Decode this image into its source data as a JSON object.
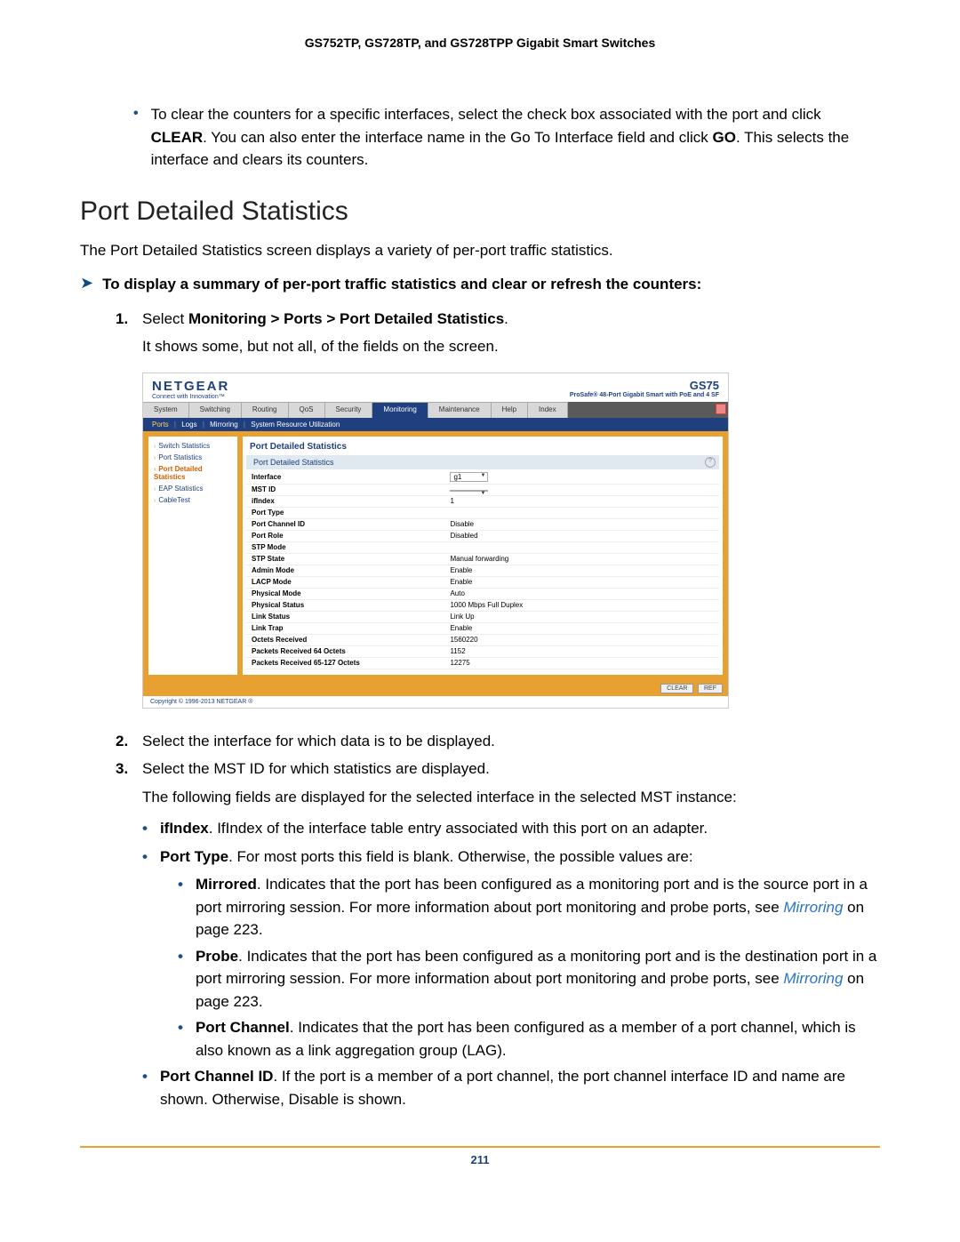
{
  "doc_header": "GS752TP, GS728TP, and GS728TPP Gigabit Smart Switches",
  "top_bullet": {
    "text": "To clear the counters for a specific interfaces, select the check box associated with the port and click ",
    "btn1": "CLEAR",
    "mid": ". You can also enter the interface name in the Go To Interface field and click ",
    "btn2": "GO",
    "tail": ". This selects the interface and clears its counters."
  },
  "section_title": "Port Detailed Statistics",
  "intro": "The Port Detailed Statistics screen displays a variety of per-port traffic statistics.",
  "lead": "To display a summary of per-port traffic statistics and clear or refresh the counters:",
  "step1": {
    "pre": "Select ",
    "path": "Monitoring > Ports > Port Detailed Statistics",
    "post": "."
  },
  "step1_sub": "It shows some, but not all, of the fields on the screen.",
  "screenshot": {
    "brand": "NETGEAR",
    "tagline": "Connect with Innovation™",
    "model": "GS75",
    "model_desc": "ProSafe® 48-Port Gigabit Smart\nwith PoE and 4 SF",
    "top_tabs": [
      "System",
      "Switching",
      "Routing",
      "QoS",
      "Security",
      "Monitoring",
      "Maintenance",
      "Help",
      "Index"
    ],
    "top_active": "Monitoring",
    "sub_tabs": [
      "Ports",
      "Logs",
      "Mirroring",
      "System Resource Utilization"
    ],
    "sub_active": "Ports",
    "side_nav": [
      "Switch Statistics",
      "Port Statistics",
      "Port Detailed Statistics",
      "EAP Statistics",
      "CableTest"
    ],
    "side_active": "Port Detailed Statistics",
    "panel_title": "Port Detailed Statistics",
    "inner_title": "Port Detailed Statistics",
    "rows": [
      {
        "label": "Interface",
        "value": "g1",
        "select": true
      },
      {
        "label": "MST ID",
        "value": "",
        "select": true
      },
      {
        "label": "ifIndex",
        "value": "1"
      },
      {
        "label": "Port Type",
        "value": ""
      },
      {
        "label": "Port Channel ID",
        "value": "Disable"
      },
      {
        "label": "Port Role",
        "value": "Disabled"
      },
      {
        "label": "STP Mode",
        "value": ""
      },
      {
        "label": "STP State",
        "value": "Manual forwarding"
      },
      {
        "label": "Admin Mode",
        "value": "Enable"
      },
      {
        "label": "LACP Mode",
        "value": "Enable"
      },
      {
        "label": "Physical Mode",
        "value": "Auto"
      },
      {
        "label": "Physical Status",
        "value": "1000 Mbps Full Duplex"
      },
      {
        "label": "Link Status",
        "value": "Link Up"
      },
      {
        "label": "Link Trap",
        "value": "Enable"
      },
      {
        "label": "Octets Received",
        "value": "1560220"
      },
      {
        "label": "Packets Received 64 Octets",
        "value": "1152"
      },
      {
        "label": "Packets Received 65-127 Octets",
        "value": "12275"
      }
    ],
    "buttons": [
      "CLEAR",
      "REF"
    ],
    "copyright": "Copyright © 1996-2013 NETGEAR ®"
  },
  "step2": "Select the interface for which data is to be displayed.",
  "step3": "Select the MST ID for which statistics are displayed.",
  "step3_sub": "The following fields are displayed for the selected interface in the selected MST instance:",
  "fields": {
    "ifindex": {
      "name": "ifIndex",
      "desc": ". IfIndex of the interface table entry associated with this port on an adapter."
    },
    "porttype": {
      "name": "Port Type",
      "desc": ". For most ports this field is blank. Otherwise, the possible values are:"
    },
    "mirrored": {
      "name": "Mirrored",
      "desc": ". Indicates that the port has been configured as a monitoring port and is the source port in a port mirroring session. For more information about port monitoring and probe ports, see ",
      "xref": "Mirroring",
      "tail": " on page 223."
    },
    "probe": {
      "name": "Probe",
      "desc": ". Indicates that the port has been configured as a monitoring port and is the destination port in a port mirroring session. For more information about port monitoring and probe ports, see ",
      "xref": "Mirroring",
      "tail": " on page 223."
    },
    "portchannel": {
      "name": "Port Channel",
      "desc": ". Indicates that the port has been configured as a member of a port channel, which is also known as a link aggregation group (LAG)."
    },
    "portchannelid": {
      "name": "Port Channel ID",
      "desc": ". If the port is a member of a port channel, the port channel interface ID and name are shown. Otherwise, Disable is shown."
    }
  },
  "page_num": "211"
}
